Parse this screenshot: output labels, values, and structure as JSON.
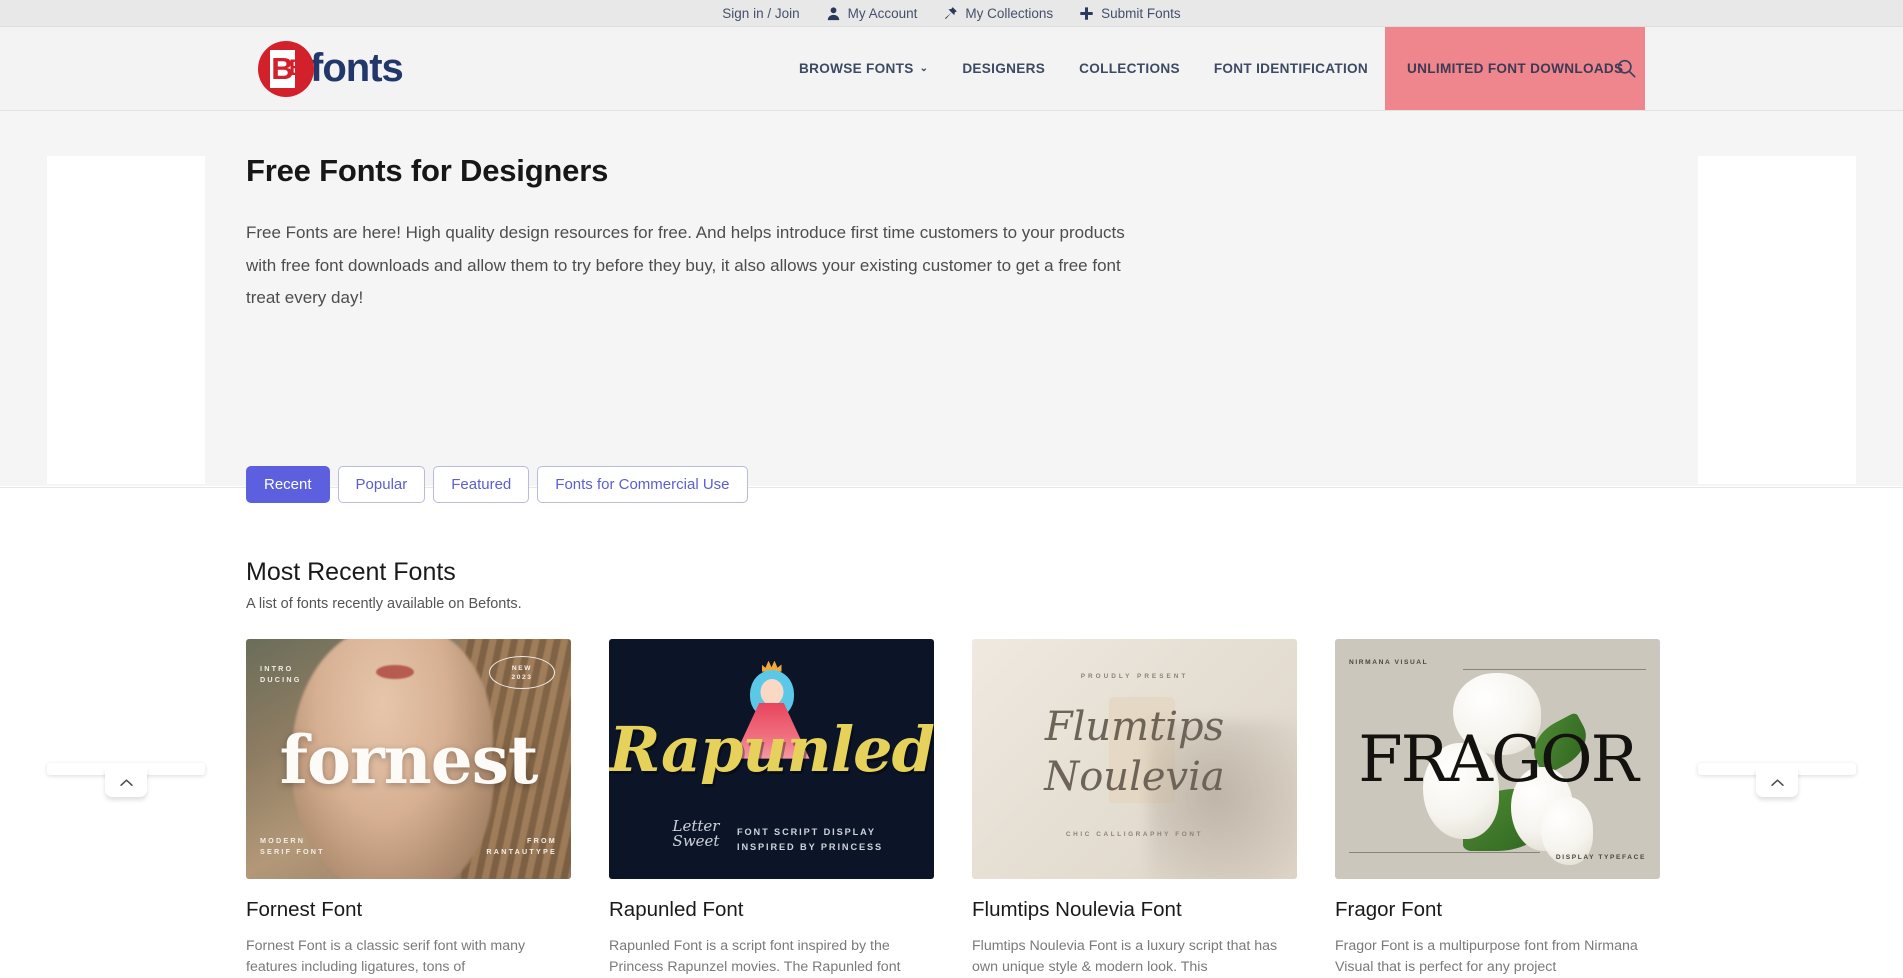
{
  "utility_bar": {
    "items": [
      {
        "label": "Sign in / Join",
        "icon": ""
      },
      {
        "label": "My Account",
        "icon": "user-icon"
      },
      {
        "label": "My Collections",
        "icon": "pin-icon"
      },
      {
        "label": "Submit Fonts",
        "icon": "plus-icon"
      }
    ]
  },
  "brand": {
    "mark_letter": "B",
    "mark_letter_small": "B",
    "wordmark": "fonts",
    "mark_color": "#d3212c",
    "word_color": "#22386b"
  },
  "nav": {
    "items": [
      {
        "label": "BROWSE FONTS",
        "has_caret": true
      },
      {
        "label": "DESIGNERS",
        "has_caret": false
      },
      {
        "label": "COLLECTIONS",
        "has_caret": false
      },
      {
        "label": "FONT IDENTIFICATION",
        "has_caret": false
      }
    ],
    "cta": {
      "label": "UNLIMITED FONT DOWNLOADS",
      "background": "#f0868d"
    },
    "caret_glyph": "⌄",
    "search_icon": "search-icon"
  },
  "hero": {
    "title": "Free Fonts for Designers",
    "paragraph": "Free Fonts are here! High quality design resources for free. And helps introduce first time customers to your products with free font downloads and allow them to try before they buy, it also allows your existing customer to get a free font treat every day!"
  },
  "filters": {
    "active_color": "#5c60df",
    "tabs": [
      {
        "label": "Recent",
        "active": true
      },
      {
        "label": "Popular",
        "active": false
      },
      {
        "label": "Featured",
        "active": false
      },
      {
        "label": "Fonts for Commercial Use",
        "active": false
      }
    ]
  },
  "section": {
    "title": "Most Recent Fonts",
    "subtitle": "A list of fonts recently available on Befonts."
  },
  "cards": [
    {
      "name": "Fornest Font",
      "description": "Fornest Font is a classic serif font with many features including ligatures, tons of",
      "preview": {
        "display_word": "fornest",
        "top_left": "INTRO\nDUCING",
        "badge_line1": "NEW",
        "badge_line2": "2023",
        "bottom_left": "MODERN\nSERIF FONT",
        "bottom_right": "FROM\nRANTAUTYPE"
      }
    },
    {
      "name": "Rapunled Font",
      "description": "Rapunled Font is a script font inspired by the Princess Rapunzel movies. The Rapunled font",
      "preview": {
        "display_word": "Rapunled",
        "brand_mark": "Letter Sweet",
        "sub_line1": "FONT SCRIPT DISPLAY",
        "sub_line2": "INSPIRED BY PRINCESS"
      }
    },
    {
      "name": "Flumtips Noulevia Font",
      "description": "Flumtips Noulevia Font is a luxury script that has own unique style & modern look. This",
      "preview": {
        "top_text": "PROUDLY PRESENT",
        "display_line1": "Flumtips",
        "display_line2": "Noulevia",
        "bottom_text": "CHIC CALLIGRAPHY FONT"
      }
    },
    {
      "name": "Fragor Font",
      "description": "Fragor Font is a multipurpose font from Nirmana Visual that is perfect for any project",
      "preview": {
        "display_word": "FRAGOR",
        "top_left": "NIRMANA VISUAL",
        "bottom_right": "DISPLAY TYPEFACE"
      }
    }
  ],
  "ad_panels": {
    "collapse_glyph": "⌃"
  }
}
